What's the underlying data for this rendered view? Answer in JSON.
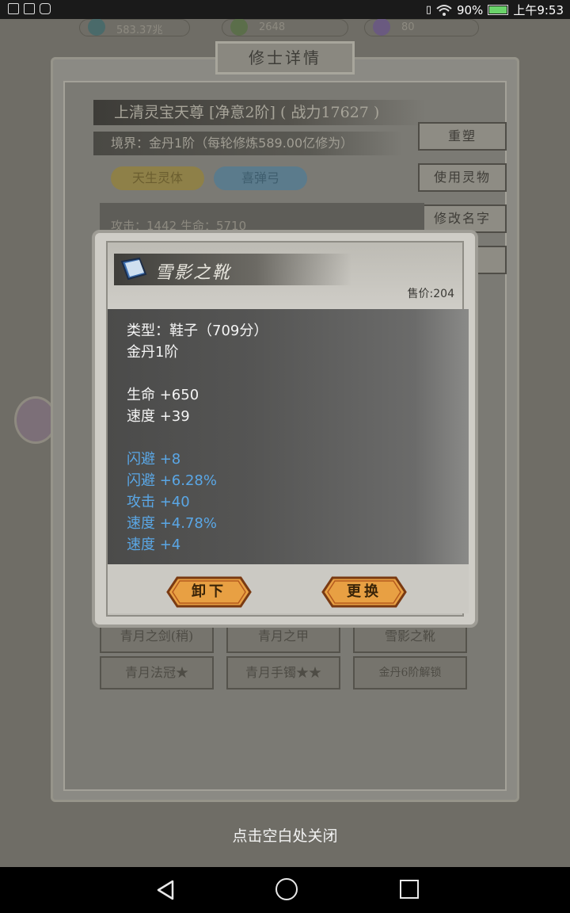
{
  "status_bar": {
    "battery": "90%",
    "battery_level": 0.9,
    "time": "上午9:53"
  },
  "resources": {
    "res1_value": "583.37兆",
    "res2_value": "2648",
    "res3_value": "80"
  },
  "panel": {
    "title": "修士详情",
    "name_line": "上清灵宝天尊 [净意2阶] ( 战力17627 )",
    "realm_line": "境界：金丹1阶（每轮修炼589.00亿修为）",
    "tags": [
      "天生灵体",
      "喜弹弓"
    ],
    "side_buttons": [
      "重塑",
      "使用灵物",
      "修改名字"
    ],
    "stats_partial": "攻击：1442          生命：5710",
    "equipment_row1": [
      "青月之剑(稍)",
      "青月之甲",
      "雪影之靴"
    ],
    "equipment_row2": [
      "青月法冠★",
      "青月手镯★★",
      "金丹6阶解锁"
    ]
  },
  "dialog": {
    "item_name": "雪影之靴",
    "price": "售价:204",
    "lines": [
      {
        "text": "类型：鞋子（709分）",
        "color": "white"
      },
      {
        "text": "金丹1阶",
        "color": "white"
      },
      {
        "text": "",
        "color": "white"
      },
      {
        "text": "生命 +650",
        "color": "white"
      },
      {
        "text": "速度 +39",
        "color": "white"
      },
      {
        "text": "",
        "color": "white"
      },
      {
        "text": "闪避 +8",
        "color": "blue"
      },
      {
        "text": "闪避 +6.28%",
        "color": "blue"
      },
      {
        "text": "攻击 +40",
        "color": "blue"
      },
      {
        "text": "速度 +4.78%",
        "color": "blue"
      },
      {
        "text": "速度 +4",
        "color": "blue"
      }
    ],
    "unequip_label": "卸下",
    "replace_label": "更换",
    "colors": {
      "white": "#f4f4f4",
      "blue": "#5aa7e6",
      "button": "#e8a043"
    }
  },
  "hint": "点击空白处关闭"
}
